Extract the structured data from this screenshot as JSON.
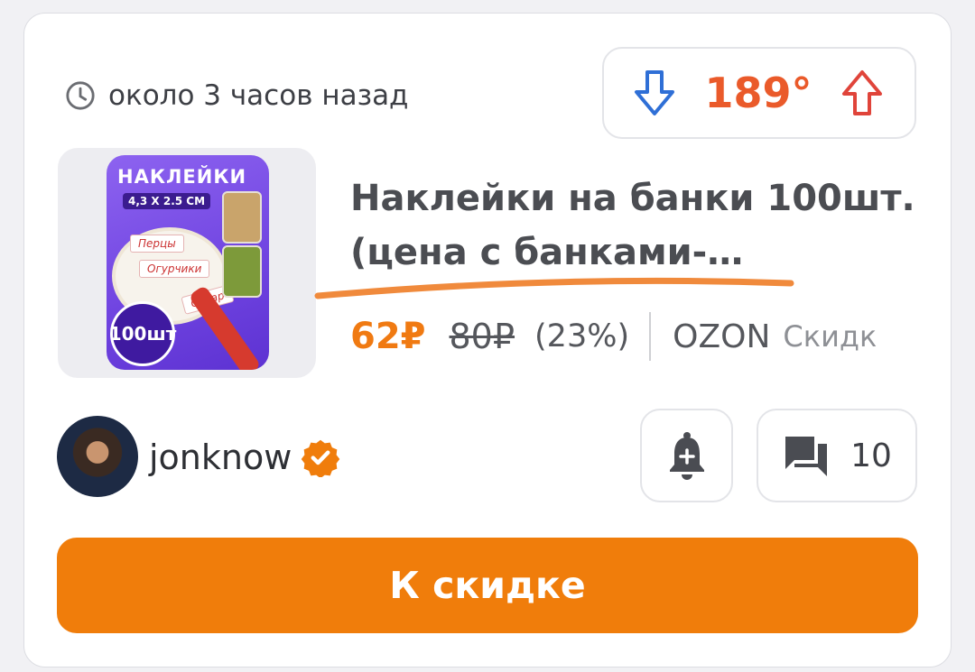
{
  "meta": {
    "time_ago": "около 3 часов назад"
  },
  "vote": {
    "temperature": "189°",
    "down_color": "#2f6fd6",
    "up_color": "#e0443a"
  },
  "product": {
    "title_line1": "Наклейки на банки 100шт.",
    "title_line2": "(цена с банками-…",
    "image": {
      "heading": "НАКЛЕЙКИ",
      "size": "4,3 Х 2.5 СМ",
      "labels": [
        "Перцы",
        "Огурчики",
        "Сахар"
      ],
      "badge": "100шт"
    }
  },
  "price": {
    "current": "62₽",
    "old": "80₽",
    "discount": "(23%)",
    "store": "OZON",
    "category": "Скидк"
  },
  "author": {
    "name": "jonknow",
    "verified_color": "#f07d0b"
  },
  "comments": {
    "count": "10"
  },
  "cta": {
    "label": "К скидке",
    "color": "#f07d0b"
  }
}
